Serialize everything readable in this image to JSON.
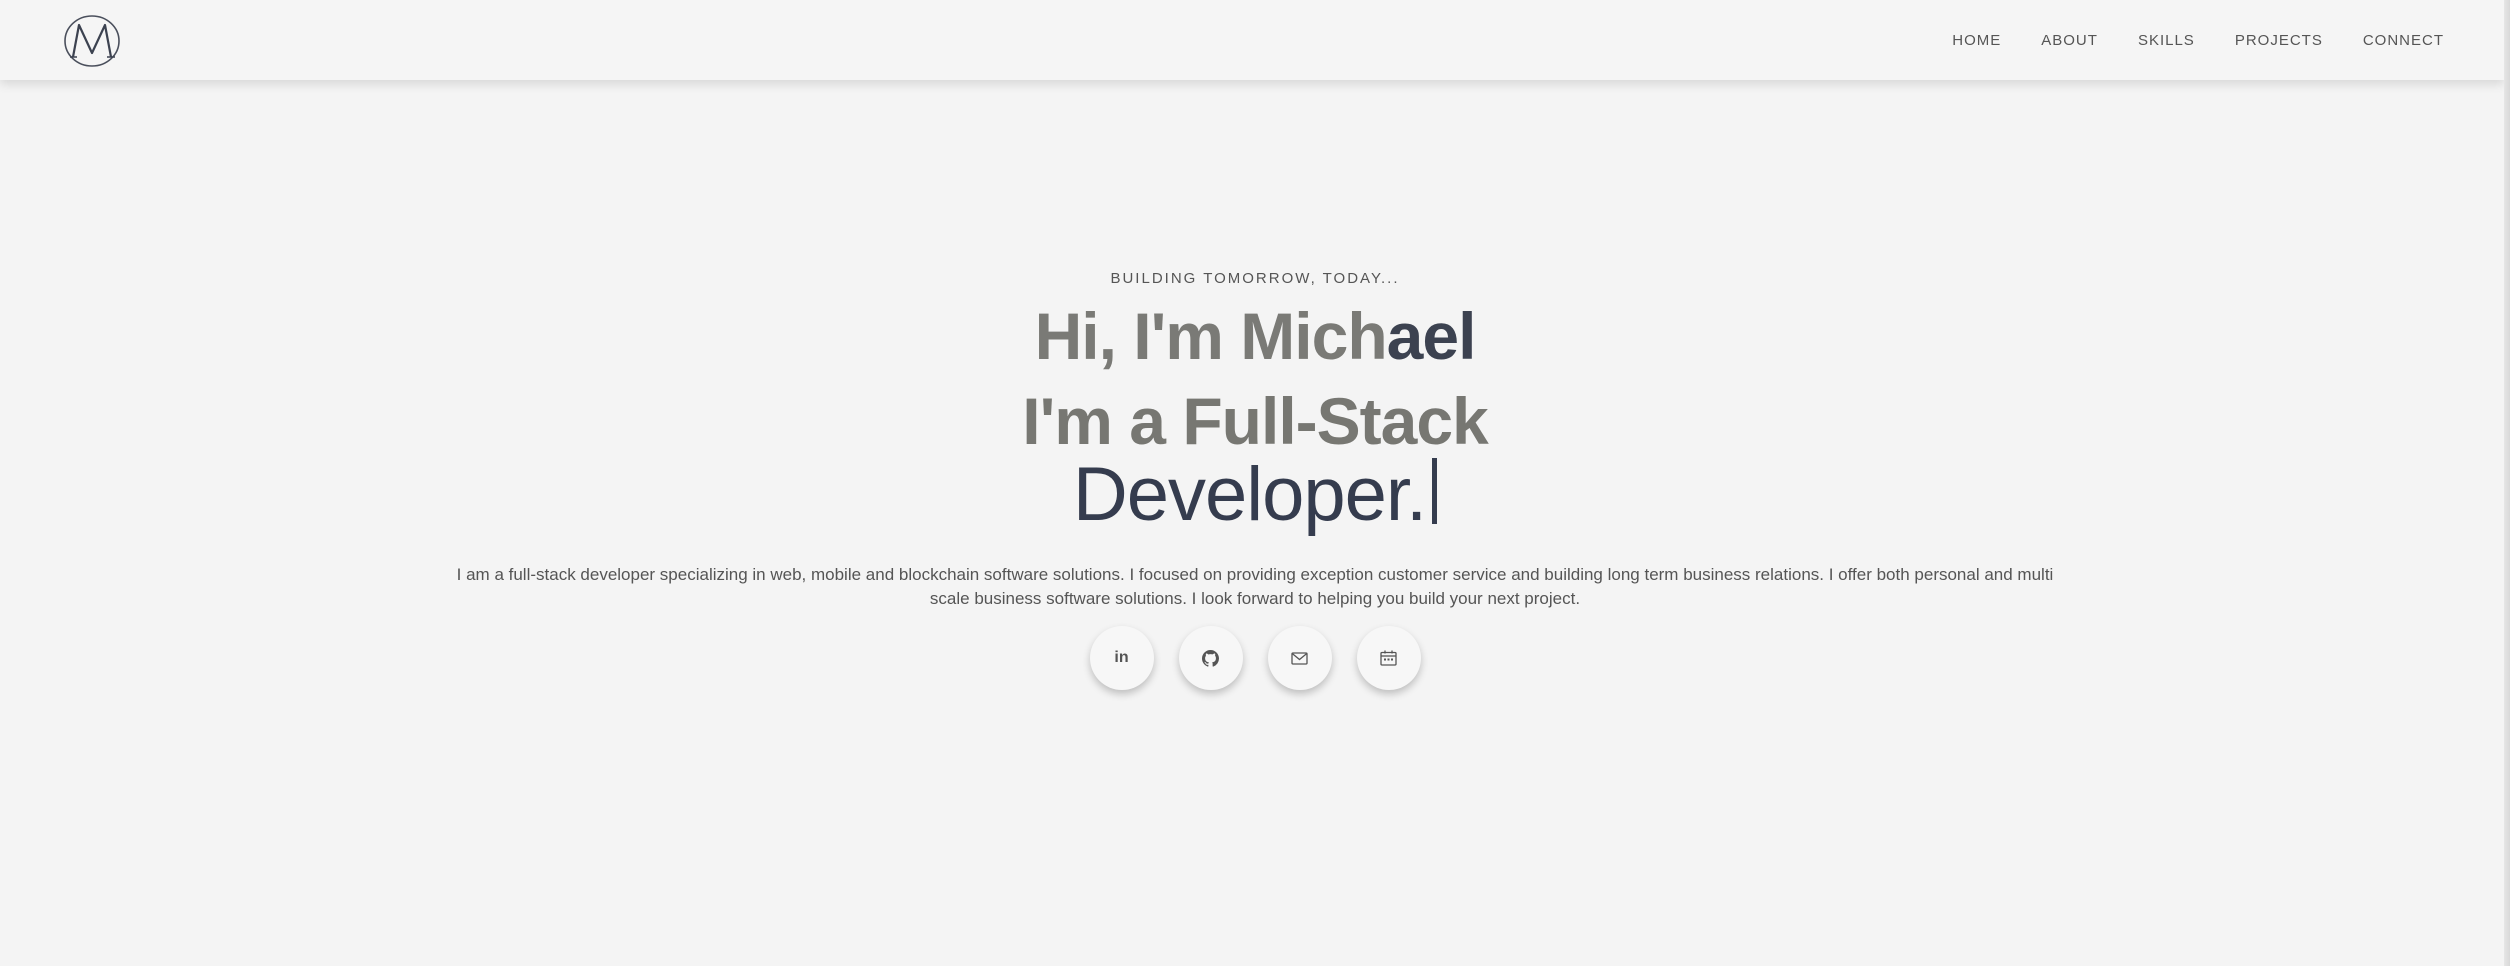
{
  "nav": {
    "logo_icon": "monogram-logo",
    "links": [
      "HOME",
      "ABOUT",
      "SKILLS",
      "PROJECTS",
      "CONNECT"
    ]
  },
  "hero": {
    "tagline": "BUILDING TOMORROW, TODAY...",
    "greeting_light": "Hi, I'm Mich",
    "greeting_dark": "ael",
    "role_line1": "I'm a Full-Stack",
    "role_line2": "Developer.",
    "bio": "I am a full-stack developer specializing in web, mobile and blockchain software solutions. I focused on providing exception customer service and building long term business relations. I offer both personal and multi scale business software solutions. I look forward to helping you build your next project."
  },
  "socials": [
    {
      "icon": "linkedin-icon",
      "label": "in"
    },
    {
      "icon": "github-icon"
    },
    {
      "icon": "mail-icon"
    },
    {
      "icon": "calendar-icon"
    }
  ],
  "colors": {
    "background": "#f4f4f4",
    "heading_gray": "#777772",
    "heading_dark": "#353c4e",
    "text": "#555555"
  }
}
